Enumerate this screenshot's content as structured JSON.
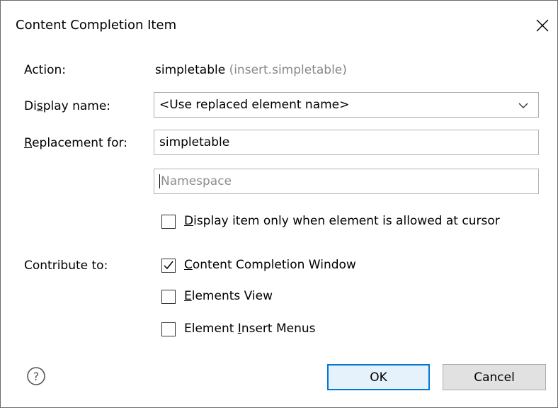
{
  "dialog": {
    "title": "Content Completion Item",
    "close_icon": "close-icon"
  },
  "action": {
    "label": "Action:",
    "value": "simpletable",
    "id": "(insert.simpletable)"
  },
  "display_name": {
    "label": "Display name:",
    "value": "<Use replaced element name>"
  },
  "replacement": {
    "label": "Replacement for:",
    "value": "simpletable",
    "namespace_placeholder": "Namespace"
  },
  "only_when_allowed": {
    "label": "Display item only when element is allowed at cursor",
    "checked": false
  },
  "contribute": {
    "label": "Contribute to:",
    "items": [
      {
        "label": "Content Completion Window",
        "checked": true
      },
      {
        "label": "Elements View",
        "checked": false
      },
      {
        "label": "Element Insert Menus",
        "checked": false
      }
    ]
  },
  "buttons": {
    "ok": "OK",
    "cancel": "Cancel",
    "help_icon": "help-icon"
  },
  "colors": {
    "accent": "#0078d7",
    "border": "#b4b4b4",
    "placeholder": "#8d8d8d"
  }
}
